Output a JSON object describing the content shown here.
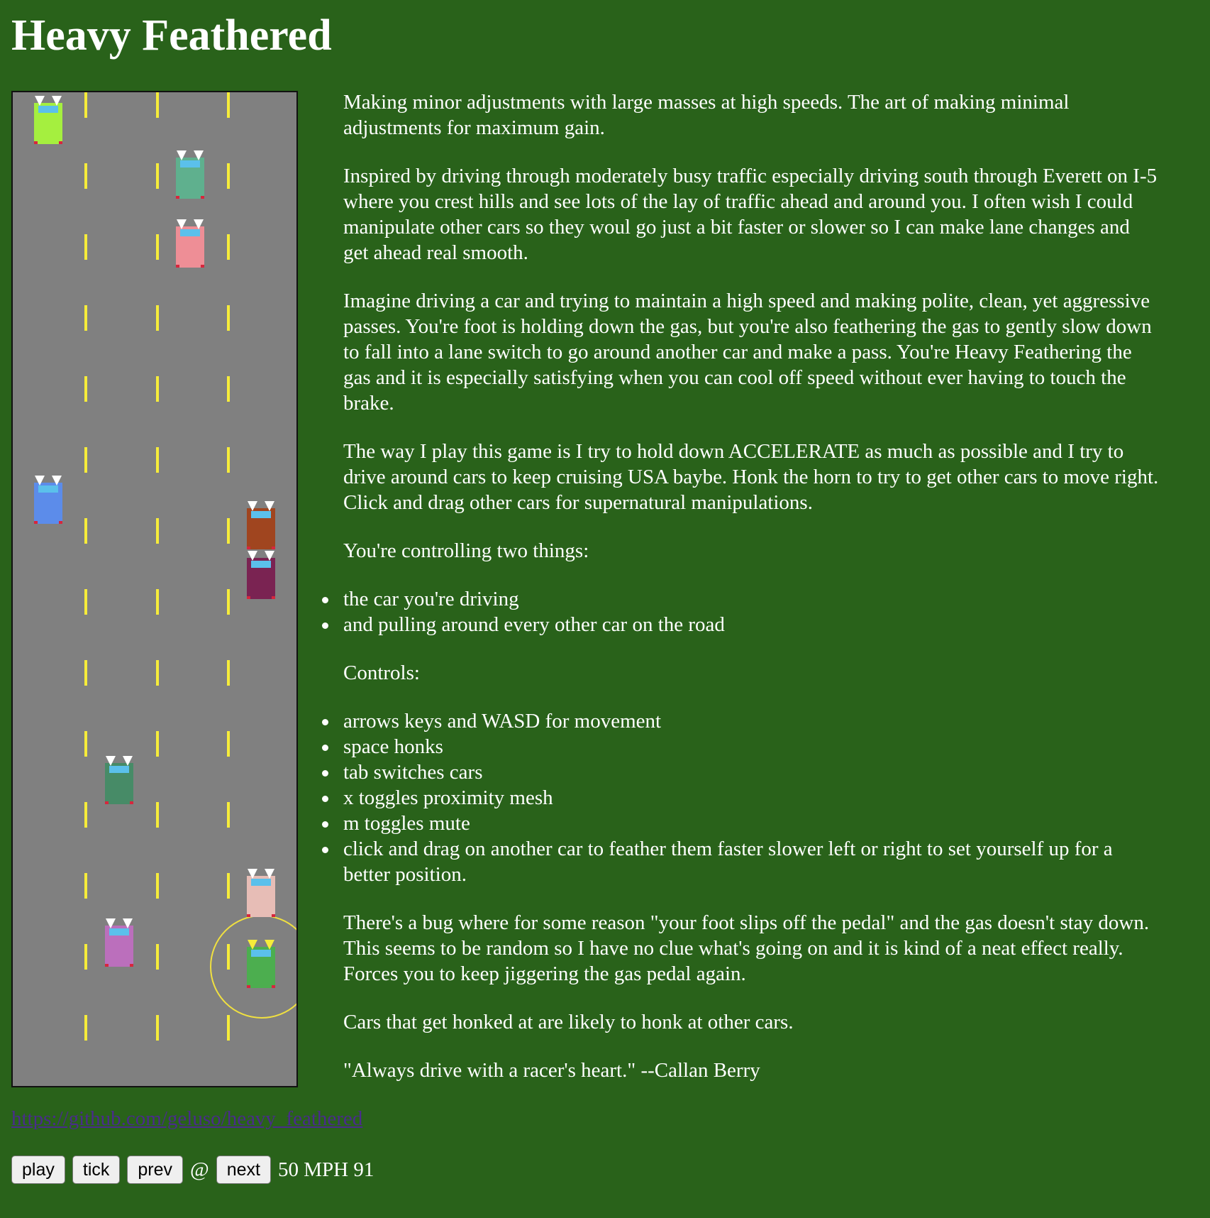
{
  "header": {
    "title": "Heavy Feathered"
  },
  "game": {
    "road_color": "#808080",
    "lane_marker_color": "#f6ec3a",
    "windshield_color": "#5bc0eb",
    "taillight_color": "#d7263d",
    "highlight_ring_color": "#f0e040",
    "player_headlight_color": "#f6ec3a",
    "npc_headlight_color": "#ffffff",
    "lanes": 4,
    "cars": [
      {
        "id": "car-lime",
        "color": "#a5ef3f",
        "lane": 1,
        "player": false
      },
      {
        "id": "car-teal",
        "color": "#5fb08e",
        "lane": 3,
        "player": false
      },
      {
        "id": "car-pink",
        "color": "#ee8e96",
        "lane": 3,
        "player": false
      },
      {
        "id": "car-blue",
        "color": "#5c8cea",
        "lane": 1,
        "player": false
      },
      {
        "id": "car-rust",
        "color": "#a0451f",
        "lane": 4,
        "player": false
      },
      {
        "id": "car-plum",
        "color": "#7a2352",
        "lane": 4,
        "player": false
      },
      {
        "id": "car-green",
        "color": "#478b67",
        "lane": 2,
        "player": false
      },
      {
        "id": "car-peach",
        "color": "#e7bdb6",
        "lane": 4,
        "player": false
      },
      {
        "id": "car-orchid",
        "color": "#bb6fbc",
        "lane": 2,
        "player": false
      },
      {
        "id": "car-player",
        "color": "#4cae4f",
        "lane": 4,
        "player": true
      }
    ]
  },
  "description": {
    "p1": "Making minor adjustments with large masses at high speeds. The art of making minimal adjustments for maximum gain.",
    "p2": "Inspired by driving through moderately busy traffic especially driving south through Everett on I-5 where you crest hills and see lots of the lay of traffic ahead and around you. I often wish I could manipulate other cars so they woul go just a bit faster or slower so I can make lane changes and get ahead real smooth.",
    "p3": "Imagine driving a car and trying to maintain a high speed and making polite, clean, yet aggressive passes. You're foot is holding down the gas, but you're also feathering the gas to gently slow down to fall into a lane switch to go around another car and make a pass. You're Heavy Feathering the gas and it is especially satisfying when you can cool off speed without ever having to touch the brake.",
    "p4": "The way I play this game is I try to hold down ACCELERATE as much as possible and I try to drive around cars to keep cruising USA baybe. Honk the horn to try to get other cars to move right. Click and drag other cars for supernatural manipulations.",
    "p5": "You're controlling two things:",
    "controlling": [
      "the car you're driving",
      "and pulling around every other car on the road"
    ],
    "p6": "Controls:",
    "controls": [
      "arrows keys and WASD for movement",
      "space honks",
      "tab switches cars",
      "x toggles proximity mesh",
      "m toggles mute",
      "click and drag on another car to feather them faster slower left or right to set yourself up for a better position."
    ],
    "p7": "There's a bug where for some reason \"your foot slips off the pedal\" and the gas doesn't stay down. This seems to be random so I have no clue what's going on and it is kind of a neat effect really. Forces you to keep jiggering the gas pedal again.",
    "p8": "Cars that get honked at are likely to honk at other cars.",
    "p9": "\"Always drive with a racer's heart.\" --Callan Berry"
  },
  "footer": {
    "repo_link": "https://github.com/geluso/heavy_feathered"
  },
  "controls_bar": {
    "play_label": "play",
    "tick_label": "tick",
    "prev_label": "prev",
    "at_sign": "@",
    "next_label": "next",
    "speed": "50 MPH 91"
  }
}
